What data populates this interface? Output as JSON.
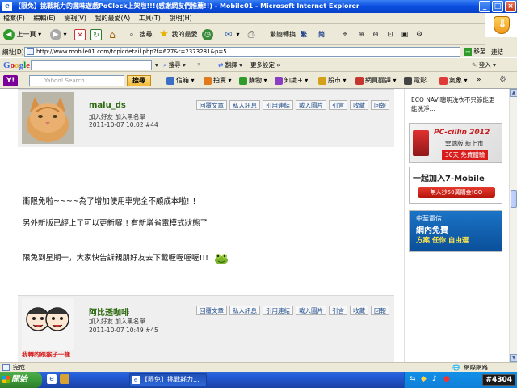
{
  "window": {
    "title": "【限免】挑戰耗力的趣味遊戲PoClock上架啦!!!(感謝網友們推薦!!) - Mobile01 - Microsoft Internet Explorer"
  },
  "menu": [
    "檔案(F)",
    "編輯(E)",
    "檢視(V)",
    "我的最愛(A)",
    "工具(T)",
    "說明(H)"
  ],
  "toolbar": {
    "back": "上一頁",
    "search": "搜尋",
    "favorites": "我的最愛",
    "convert_simplified": "繁簡轉換",
    "convert_trad": "繁",
    "convert_simp": "简"
  },
  "address": {
    "label": "網址(D)",
    "url": "http://www.mobile01.com/topicdetail.php?f=627&t=2373281&p=5",
    "go": "移至",
    "links": "連結"
  },
  "google": {
    "logo": "Google",
    "search_btn": "搜尋",
    "translate": "翻譯",
    "more": "更多設定",
    "login": "登入"
  },
  "yahoo": {
    "logo": "Y!",
    "placeholder": "Yahoo! Search",
    "search_btn": "搜尋",
    "links": [
      "信箱",
      "拍賣",
      "購物",
      "知識+",
      "股市",
      "網頁翻譯",
      "電影",
      "氣象"
    ]
  },
  "posts": [
    {
      "username": "malu_ds",
      "sub": "加入好友  加入黑名單",
      "date": "2011-10-07 10:02  #44",
      "actions": [
        "回覆文章",
        "私人訊息",
        "引用連結",
        "載入圖片",
        "引言",
        "收藏",
        "回報"
      ]
    },
    {
      "username": "阿比透咖啡",
      "sub": "加入好友  加入黑名單",
      "date": "2011-10-07 10:49  #45",
      "actions": [
        "回覆文章",
        "私人訊息",
        "引用連結",
        "載入圖片",
        "引言",
        "收藏",
        "回報"
      ],
      "avatar_caption": "我轉的跟猴子一樣"
    }
  ],
  "post_body": [
    "衝限免啦~~~~為了增加使用率完全不顧成本啦!!!",
    "另外新版已經上了可以更新囉!! 有新增省電模式狀態了",
    "限免到星期一，大家快告訴親朋好友去下載喔喔喔喔!!!"
  ],
  "sidebar": {
    "text_line1": "ECO NAVI聰明洗衣不只節能更",
    "text_line2": "能洗淨…",
    "ad1": {
      "brand": "PC-cillin 2012",
      "sub": "雲端版 新上市",
      "cta": "30天 免費體驗"
    },
    "ad2": {
      "title": "一起加入7-Mobile",
      "cta": "無人抄50萬購金!GO"
    },
    "ad3": {
      "line1": "中華電信",
      "line2": "網內免費",
      "line3": "方案 任你 自由選"
    }
  },
  "status": {
    "text": "完成",
    "zone": "網際網路"
  },
  "taskbar": {
    "start": "開始",
    "task": "【限免】挑戰耗力...",
    "badge": "#4304"
  }
}
